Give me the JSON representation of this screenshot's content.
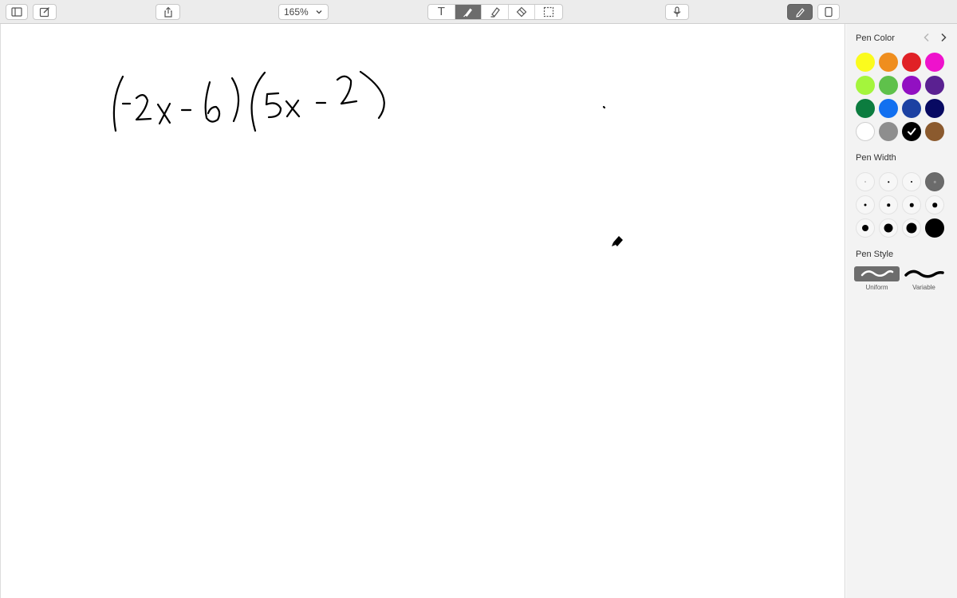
{
  "toolbar": {
    "zoom_value": "165%",
    "buttons": [
      "sidebar-toggle",
      "new-note",
      "share",
      "microphone",
      "markup",
      "page"
    ],
    "tools": [
      "text",
      "pen",
      "highlighter",
      "eraser",
      "selection"
    ],
    "text_tool_glyph": "T",
    "active_tool": "pen"
  },
  "canvas": {
    "handwriting": "(-2x-6)(5x-2)"
  },
  "panel": {
    "pen_color_label": "Pen Color",
    "pen_width_label": "Pen Width",
    "pen_style_label": "Pen Style",
    "colors": [
      "#fbfb1d",
      "#ef8e1e",
      "#e02126",
      "#ee12cc",
      "#a4f53c",
      "#5fc14b",
      "#9210c2",
      "#5a2191",
      "#0c7c3f",
      "#1270f0",
      "#1c41a2",
      "#080a62",
      "#ffffff",
      "#8e8e8e",
      "#000000",
      "#8b5a2e"
    ],
    "selected_color": "#000000",
    "widths": [
      1,
      1.5,
      2,
      2.5,
      3,
      3.5,
      4.5,
      5.5,
      8,
      11,
      13,
      22
    ],
    "selected_width_index": 3,
    "styles": [
      "Uniform",
      "Variable"
    ],
    "selected_style": "Uniform"
  }
}
